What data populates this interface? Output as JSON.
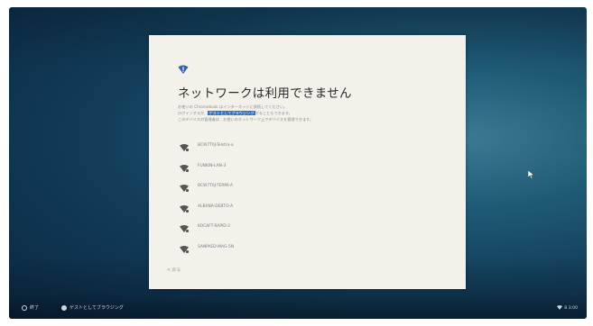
{
  "colors": {
    "accent": "#2f73c8",
    "dialog_bg": "#f4f1ea",
    "desktop_dark": "#0a2640",
    "desktop_light": "#3d7a92"
  },
  "dialog": {
    "header_icon": "wifi-alert-icon",
    "title": "ネットワークは利用できません",
    "description": {
      "line1": "お使いの Chromebook はインターネットに接続してください。",
      "line2_before": "ログインするか、",
      "line2_link": "ゲストとしてブラウジング",
      "line2_after": "することもできます。",
      "line3": "このデバイスの管理者は、お使いのネットワーク上でデバイスを管理できます。"
    },
    "networks": [
      {
        "name": "BCW7T0J-Telstra-a",
        "icon": "wifi-locked-icon"
      },
      {
        "name": "FUNKIN-LAN-3",
        "icon": "wifi-locked-icon"
      },
      {
        "name": "BCW7T0J-TERMI-A",
        "icon": "wifi-locked-icon"
      },
      {
        "name": "ALBANA-DEBTO-A",
        "icon": "wifi-locked-icon"
      },
      {
        "name": "KOCAFT-RAPID-2",
        "icon": "wifi-locked-icon"
      },
      {
        "name": "SANPAED-MAG-5N",
        "icon": "wifi-locked-icon"
      }
    ],
    "back_label": "< 戻る"
  },
  "shelf": {
    "shutdown_label": "終了",
    "guest_label": "ゲストとしてブラウジング",
    "status_text": "8 3:00"
  }
}
